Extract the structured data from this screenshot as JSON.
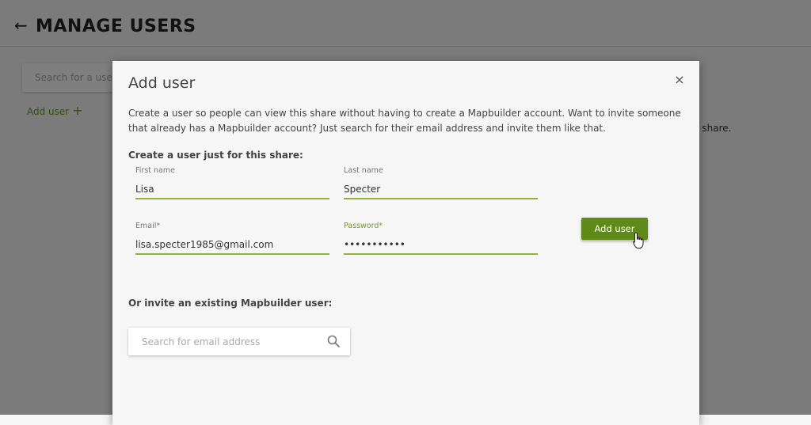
{
  "page": {
    "title": "MANAGE USERS",
    "search_placeholder": "Search for a user",
    "add_user_link": "Add user",
    "add_icon": "+",
    "share_text_fragment": "ur share."
  },
  "modal": {
    "title": "Add user",
    "intro": "Create a user so people can view this share without having to create a Mapbuilder account. Want to invite someone that already has a Mapbuilder account? Just search for their email address and invite them like that.",
    "create_heading": "Create a user just for this share:",
    "fields": {
      "first_name": {
        "label": "First name",
        "value": "Lisa"
      },
      "last_name": {
        "label": "Last name",
        "value": "Specter"
      },
      "email": {
        "label": "Email*",
        "value": "lisa.specter1985@gmail.com"
      },
      "password": {
        "label": "Password*",
        "value": "•••••••••••"
      }
    },
    "add_button": "Add user",
    "invite_heading": "Or invite an existing Mapbuilder user:",
    "invite_search_placeholder": "Search for email address",
    "close_symbol": "×"
  },
  "colors": {
    "accent": "#6e9a1e",
    "button": "#5f8a17"
  },
  "icons": [
    "back-arrow-icon",
    "plus-icon",
    "close-icon",
    "search-icon",
    "hand-pointer-icon"
  ]
}
